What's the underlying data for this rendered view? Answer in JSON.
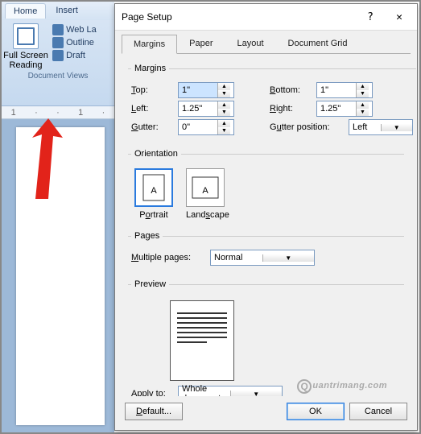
{
  "ribbon": {
    "tabs": [
      "Home",
      "Insert"
    ],
    "big_label_l1": "Full Screen",
    "big_label_l2": "Reading",
    "items": [
      "Web La",
      "Outline",
      "Draft"
    ],
    "group": "Document Views"
  },
  "ruler": {
    "marks": [
      "1",
      "·",
      "·",
      "1",
      "·"
    ]
  },
  "dialog": {
    "title": "Page Setup",
    "help": "?",
    "close": "✕",
    "tabs": {
      "margins": "Margins",
      "paper": "Paper",
      "layout": "Layout",
      "grid": "Document Grid"
    },
    "margins_group": "Margins",
    "labels": {
      "top": "Top:",
      "bottom": "Bottom:",
      "left": "Left:",
      "right": "Right:",
      "gutter": "Gutter:",
      "gutter_pos": "Gutter position:"
    },
    "values": {
      "top": "1\"",
      "bottom": "1\"",
      "left": "1.25\"",
      "right": "1.25\"",
      "gutter": "0\"",
      "gutter_pos": "Left"
    },
    "orientation": {
      "group": "Orientation",
      "portrait": "Portrait",
      "landscape": "Landscape"
    },
    "pages": {
      "group": "Pages",
      "label": "Multiple pages:",
      "value": "Normal"
    },
    "preview": "Preview",
    "apply": {
      "label": "Apply to:",
      "value": "Whole document"
    },
    "buttons": {
      "default": "Default...",
      "ok": "OK",
      "cancel": "Cancel"
    }
  },
  "watermark": "uantrimang.com"
}
